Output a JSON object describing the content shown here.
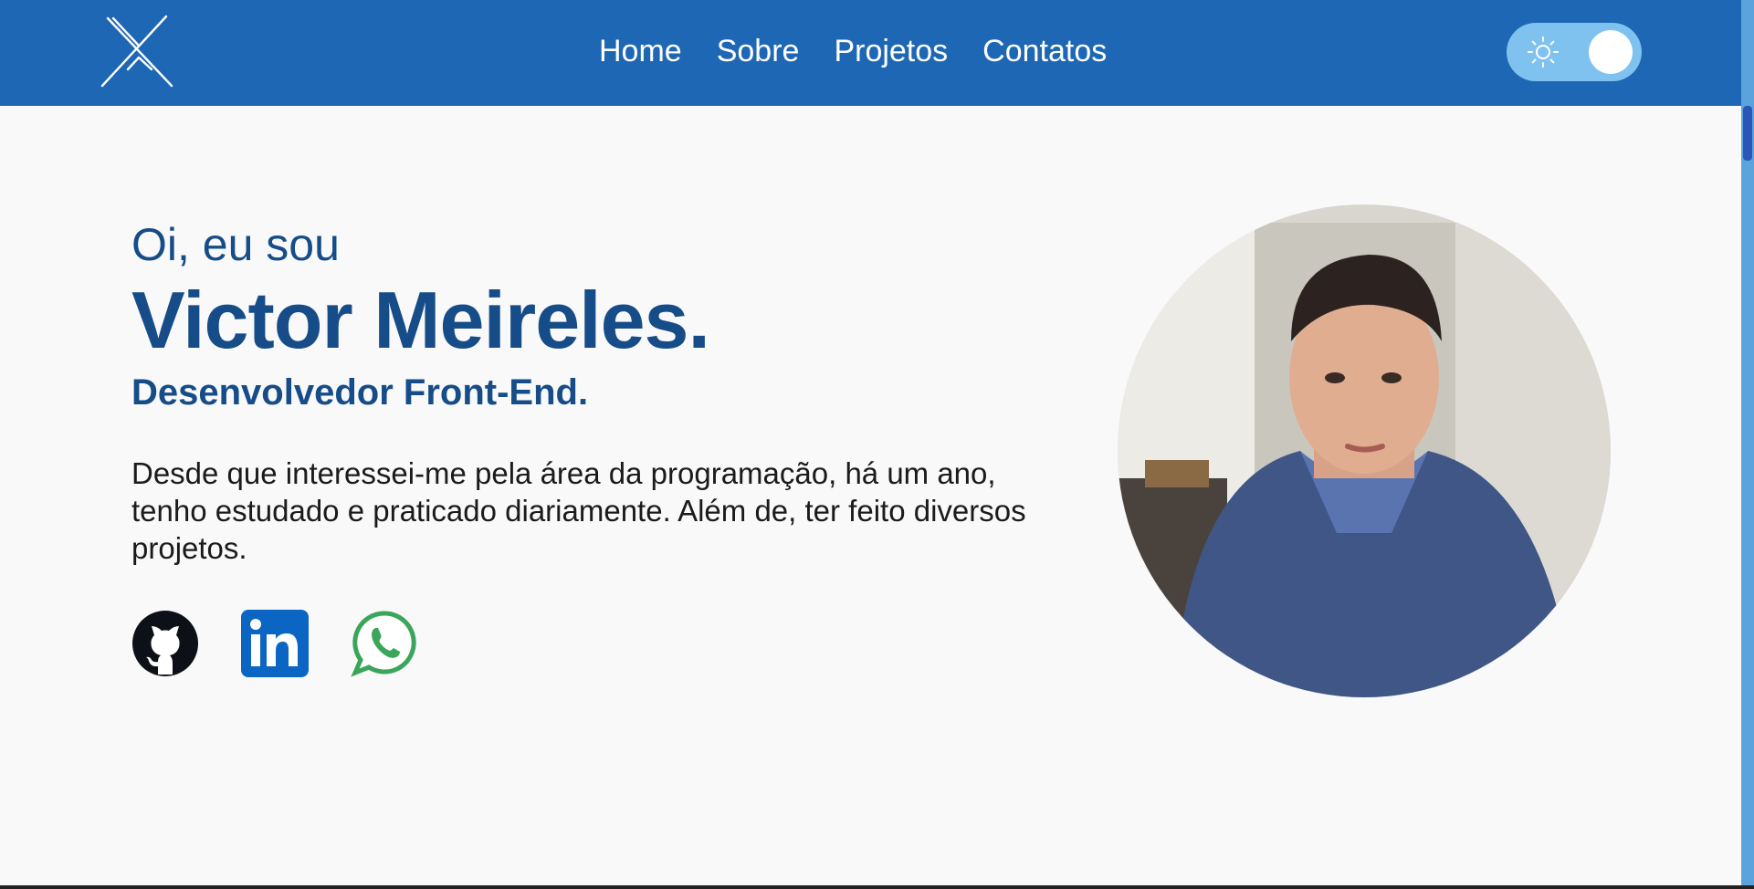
{
  "header": {
    "logo_icon": "stylized-x-monogram",
    "nav": [
      {
        "label": "Home"
      },
      {
        "label": "Sobre"
      },
      {
        "label": "Projetos"
      },
      {
        "label": "Contatos"
      }
    ],
    "theme_toggle": {
      "icon": "sun-icon",
      "state": "light"
    }
  },
  "hero": {
    "greeting": "Oi, eu sou",
    "name": "Victor Meireles.",
    "role": "Desenvolvedor Front-End.",
    "description": "Desde que interessei-me pela área da programação, há um ano, tenho estudado e praticado diariamente. Além de, ter feito diversos projetos.",
    "socials": [
      {
        "icon": "github-icon"
      },
      {
        "icon": "linkedin-icon"
      },
      {
        "icon": "whatsapp-icon"
      }
    ],
    "avatar_icon": "profile-photo"
  },
  "colors": {
    "navbar": "#1e67b4",
    "heading": "#164d88",
    "background": "#f9f9fa",
    "toggle": "#7fc2f0",
    "linkedin": "#0a66c2",
    "whatsapp": "#3aa65a"
  }
}
